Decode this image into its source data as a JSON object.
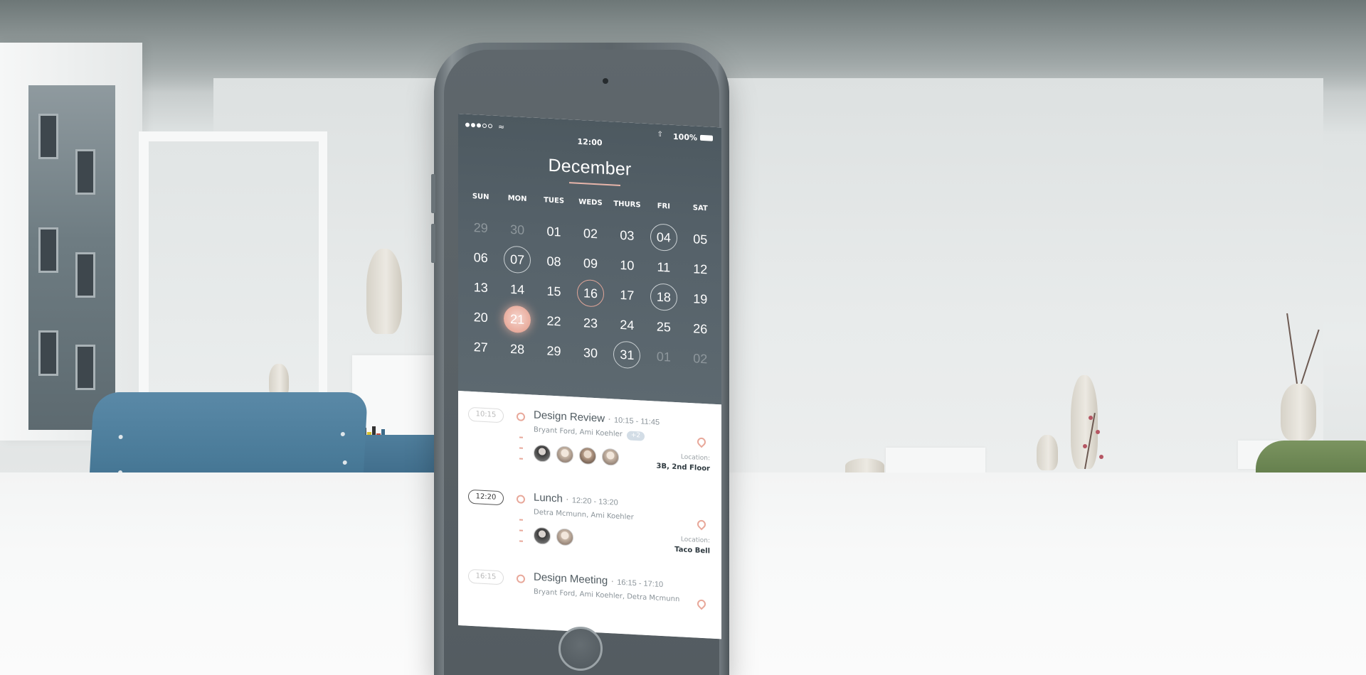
{
  "status_bar": {
    "signal_icon": "signal-dots-icon",
    "wifi_icon": "wifi-icon",
    "time": "12:00",
    "battery_percent": "100%",
    "bluetooth_icon": "bluetooth-icon"
  },
  "calendar": {
    "month": "December",
    "weekdays": [
      "SUN",
      "MON",
      "TUES",
      "WEDS",
      "THURS",
      "FRI",
      "SAT"
    ],
    "days": [
      {
        "label": "29",
        "state": "muted"
      },
      {
        "label": "30",
        "state": "muted"
      },
      {
        "label": "01",
        "state": "normal"
      },
      {
        "label": "02",
        "state": "normal"
      },
      {
        "label": "03",
        "state": "normal"
      },
      {
        "label": "04",
        "state": "ring"
      },
      {
        "label": "05",
        "state": "normal"
      },
      {
        "label": "06",
        "state": "normal"
      },
      {
        "label": "07",
        "state": "ring"
      },
      {
        "label": "08",
        "state": "normal"
      },
      {
        "label": "09",
        "state": "normal"
      },
      {
        "label": "10",
        "state": "normal"
      },
      {
        "label": "11",
        "state": "normal"
      },
      {
        "label": "12",
        "state": "normal"
      },
      {
        "label": "13",
        "state": "normal"
      },
      {
        "label": "14",
        "state": "normal"
      },
      {
        "label": "15",
        "state": "normal"
      },
      {
        "label": "16",
        "state": "ring-accent"
      },
      {
        "label": "17",
        "state": "normal"
      },
      {
        "label": "18",
        "state": "ring"
      },
      {
        "label": "19",
        "state": "normal"
      },
      {
        "label": "20",
        "state": "normal"
      },
      {
        "label": "21",
        "state": "selected"
      },
      {
        "label": "22",
        "state": "normal"
      },
      {
        "label": "23",
        "state": "normal"
      },
      {
        "label": "24",
        "state": "normal"
      },
      {
        "label": "25",
        "state": "normal"
      },
      {
        "label": "26",
        "state": "normal"
      },
      {
        "label": "27",
        "state": "normal"
      },
      {
        "label": "28",
        "state": "normal"
      },
      {
        "label": "29",
        "state": "normal"
      },
      {
        "label": "30",
        "state": "normal"
      },
      {
        "label": "31",
        "state": "ring"
      },
      {
        "label": "01",
        "state": "muted"
      },
      {
        "label": "02",
        "state": "muted"
      }
    ]
  },
  "events": [
    {
      "time_pill": "10:15",
      "active": false,
      "title": "Design Review",
      "time_range": "10:15 - 11:45",
      "people": "Bryant Ford, Ami Koehler",
      "extra": "+2",
      "avatar_count": 4,
      "location_label": "Location:",
      "location": "3B, 2nd Floor"
    },
    {
      "time_pill": "12:20",
      "active": true,
      "title": "Lunch",
      "time_range": "12:20 - 13:20",
      "people": "Detra Mcmunn, Ami Koehler",
      "extra": "",
      "avatar_count": 2,
      "location_label": "Location:",
      "location": "Taco Bell"
    },
    {
      "time_pill": "16:15",
      "active": false,
      "title": "Design Meeting",
      "time_range": "16:15 - 17:10",
      "people": "Bryant Ford, Ami Koehler, Detra Mcmunn",
      "extra": "",
      "avatar_count": 0,
      "location_label": "",
      "location": ""
    }
  ],
  "colors": {
    "accent": "#e8a89a",
    "calendar_bg": "#56626a",
    "chair": "#4a7b99"
  }
}
